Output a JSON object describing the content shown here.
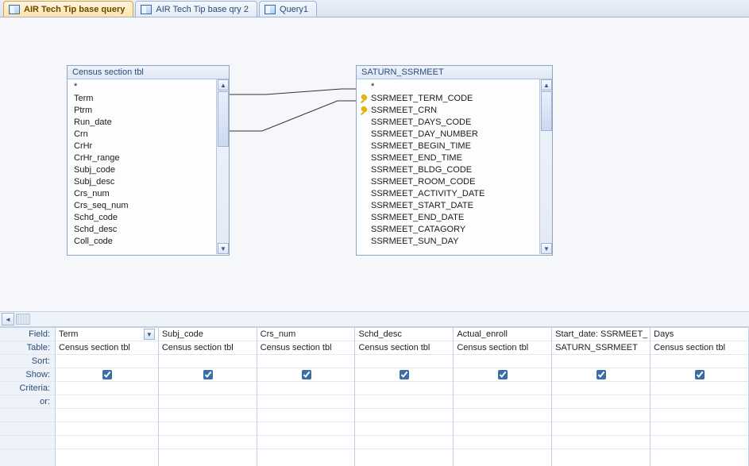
{
  "tabs": [
    {
      "label": "AIR Tech Tip base query",
      "active": true
    },
    {
      "label": "AIR Tech Tip base qry 2",
      "active": false
    },
    {
      "label": "Query1",
      "active": false
    }
  ],
  "table_left": {
    "title": "Census section tbl",
    "fields": [
      "*",
      "Term",
      "Ptrm",
      "Run_date",
      "Crn",
      "CrHr",
      "CrHr_range",
      "Subj_code",
      "Subj_desc",
      "Crs_num",
      "Crs_seq_num",
      "Schd_code",
      "Schd_desc",
      "Coll_code"
    ]
  },
  "table_right": {
    "title": "SATURN_SSRMEET",
    "fields": [
      {
        "name": "*",
        "pk": false
      },
      {
        "name": "SSRMEET_TERM_CODE",
        "pk": true
      },
      {
        "name": "SSRMEET_CRN",
        "pk": true
      },
      {
        "name": "SSRMEET_DAYS_CODE",
        "pk": false
      },
      {
        "name": "SSRMEET_DAY_NUMBER",
        "pk": false
      },
      {
        "name": "SSRMEET_BEGIN_TIME",
        "pk": false
      },
      {
        "name": "SSRMEET_END_TIME",
        "pk": false
      },
      {
        "name": "SSRMEET_BLDG_CODE",
        "pk": false
      },
      {
        "name": "SSRMEET_ROOM_CODE",
        "pk": false
      },
      {
        "name": "SSRMEET_ACTIVITY_DATE",
        "pk": false
      },
      {
        "name": "SSRMEET_START_DATE",
        "pk": false
      },
      {
        "name": "SSRMEET_END_DATE",
        "pk": false
      },
      {
        "name": "SSRMEET_CATAGORY",
        "pk": false
      },
      {
        "name": "SSRMEET_SUN_DAY",
        "pk": false
      }
    ]
  },
  "qbe_rows": [
    "Field:",
    "Table:",
    "Sort:",
    "Show:",
    "Criteria:",
    "or:",
    " ",
    " ",
    " "
  ],
  "qbe_cols": [
    {
      "field": "Term",
      "table": "Census section tbl",
      "show": true,
      "first": true
    },
    {
      "field": "Subj_code",
      "table": "Census section tbl",
      "show": true
    },
    {
      "field": "Crs_num",
      "table": "Census section tbl",
      "show": true
    },
    {
      "field": "Schd_desc",
      "table": "Census section tbl",
      "show": true
    },
    {
      "field": "Actual_enroll",
      "table": "Census section tbl",
      "show": true
    },
    {
      "field": "Start_date: SSRMEET_",
      "table": "SATURN_SSRMEET",
      "show": true
    },
    {
      "field": "Days",
      "table": "Census section tbl",
      "show": true
    }
  ],
  "icons": {
    "up": "▲",
    "down": "▼",
    "left": "◄"
  }
}
